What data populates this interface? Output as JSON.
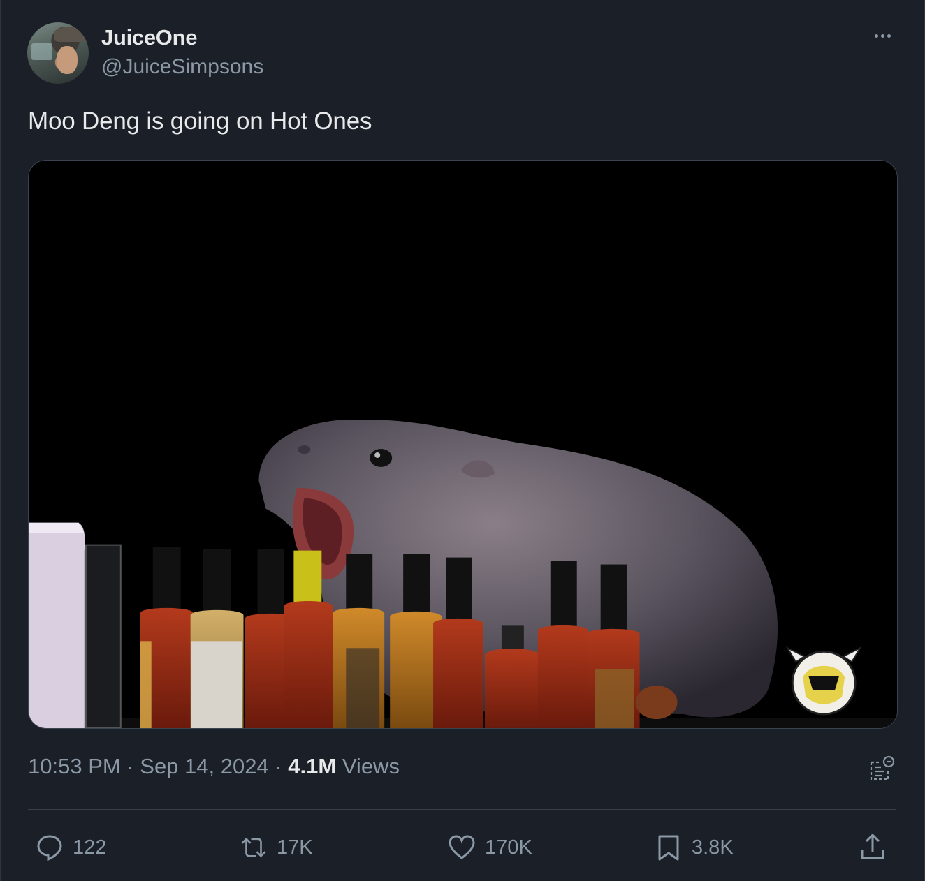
{
  "author": {
    "name": "JuiceOne",
    "handle": "@JuiceSimpsons"
  },
  "tweet": {
    "text": "Moo Deng is going on Hot Ones"
  },
  "meta": {
    "time": "10:53 PM",
    "separator1": " · ",
    "date": "Sep 14, 2024",
    "separator2": " · ",
    "views_count": "4.1M",
    "views_label": " Views"
  },
  "actions": {
    "replies": "122",
    "reposts": "17K",
    "likes": "170K",
    "bookmarks": "3.8K"
  },
  "icons": {
    "more": "more-icon",
    "reply": "reply-icon",
    "repost": "repost-icon",
    "like": "heart-icon",
    "bookmark": "bookmark-icon",
    "share": "share-icon",
    "community_note": "community-note-icon"
  },
  "colors": {
    "background": "#1b1f27",
    "text_primary": "#e7e9ea",
    "text_secondary": "#8b98a5"
  }
}
